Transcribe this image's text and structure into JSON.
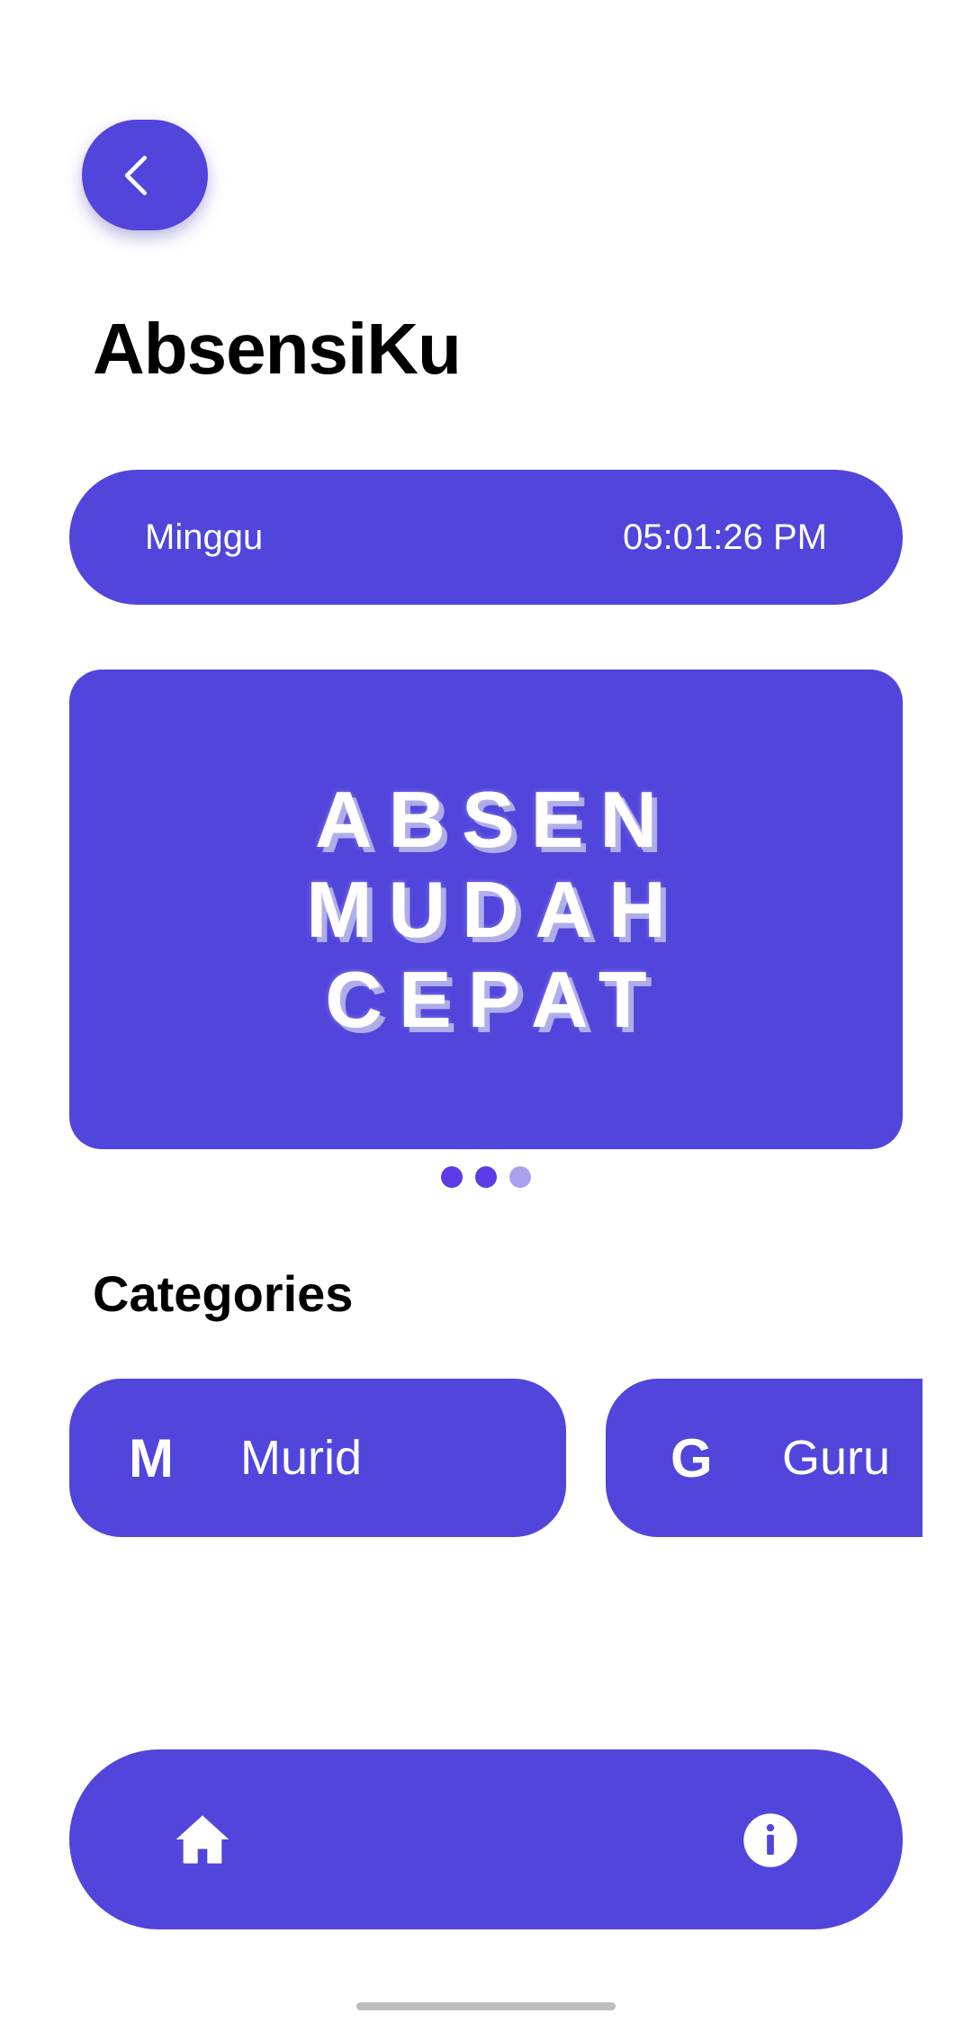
{
  "header": {
    "back_icon": "chevron-left-icon",
    "title": "AbsensiKu"
  },
  "datetime": {
    "day": "Minggu",
    "time": "05:01:26 PM"
  },
  "banner": {
    "lines": [
      "ABSEN",
      "MUDAH",
      "CEPAT"
    ],
    "dots": {
      "count": 3,
      "active": [
        0,
        1
      ]
    }
  },
  "categories": {
    "title": "Categories",
    "items": [
      {
        "letter": "M",
        "label": "Murid"
      },
      {
        "letter": "G",
        "label": "Guru"
      }
    ]
  },
  "bottom_nav": {
    "items": [
      {
        "icon": "home-icon"
      },
      {
        "icon": "info-icon"
      }
    ]
  },
  "colors": {
    "primary": "#5145dc",
    "dot_active": "#5b3ce6",
    "dot_inactive": "#a9a2ee",
    "text_on_primary": "#ffffff"
  }
}
